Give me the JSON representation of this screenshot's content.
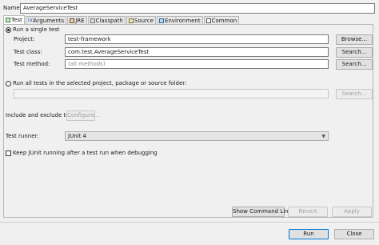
{
  "name_label": "Name:",
  "name_value": "AverageServiceTest",
  "tabs": [
    {
      "label": "Test"
    },
    {
      "label": "Arguments"
    },
    {
      "label": "JRE"
    },
    {
      "label": "Classpath"
    },
    {
      "label": "Source"
    },
    {
      "label": "Environment"
    },
    {
      "label": "Common"
    }
  ],
  "single_test": {
    "radio_label": "Run a single test",
    "project_label": "Project:",
    "project_value": "test-framework",
    "browse_label": "Browse...",
    "test_class_label": "Test class:",
    "test_class_value": "com.test.AverageServiceTest",
    "search_label": "Search...",
    "test_method_label": "Test method:",
    "test_method_placeholder": "(all methods)",
    "method_search_label": "Search..."
  },
  "all_tests": {
    "radio_label": "Run all tests in the selected project, package or source folder:",
    "search_label": "Search..."
  },
  "tags": {
    "label": "Include and exclude tags:",
    "configure_label": "Configure..."
  },
  "runner": {
    "label": "Test runner:",
    "value": "JUnit 4"
  },
  "keep_junit": {
    "label": "Keep JUnit running after a test run when debugging",
    "checked": false
  },
  "actions": {
    "show_command_line": "Show Command Line",
    "revert": "Revert",
    "apply": "Apply"
  },
  "footer": {
    "run": "Run",
    "close": "Close"
  }
}
